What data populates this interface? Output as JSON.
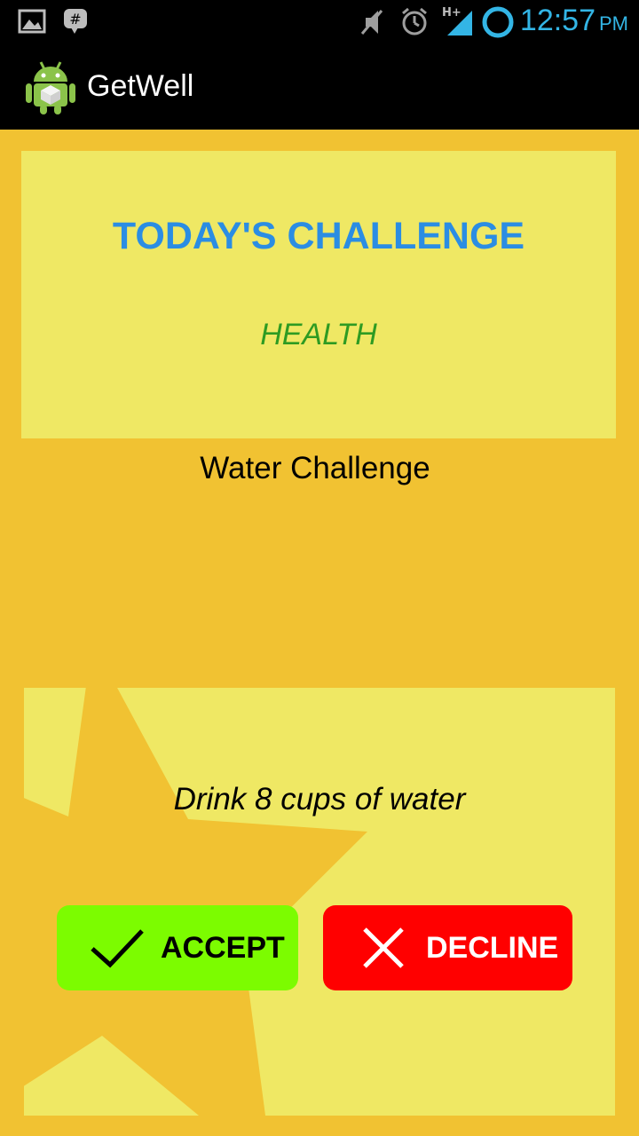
{
  "status_bar": {
    "time": "12:57",
    "ampm": "PM",
    "network": "H+",
    "icons": [
      "gallery-icon",
      "chat-icon",
      "mute-icon",
      "alarm-icon",
      "signal-icon",
      "sync-icon"
    ]
  },
  "action_bar": {
    "app_title": "GetWell",
    "logo": "android-robot-icon"
  },
  "challenge": {
    "heading": "TODAY'S CHALLENGE",
    "category": "HEALTH",
    "name": "Water Challenge",
    "description": "Drink 8 cups of water"
  },
  "buttons": {
    "accept_label": "ACCEPT",
    "decline_label": "DECLINE"
  },
  "colors": {
    "background": "#f1c232",
    "card": "#efe864",
    "heading": "#2b8de3",
    "category": "#2e9b22",
    "accept": "#7cfc00",
    "decline": "#ff0000",
    "status_accent": "#33b5e5"
  }
}
